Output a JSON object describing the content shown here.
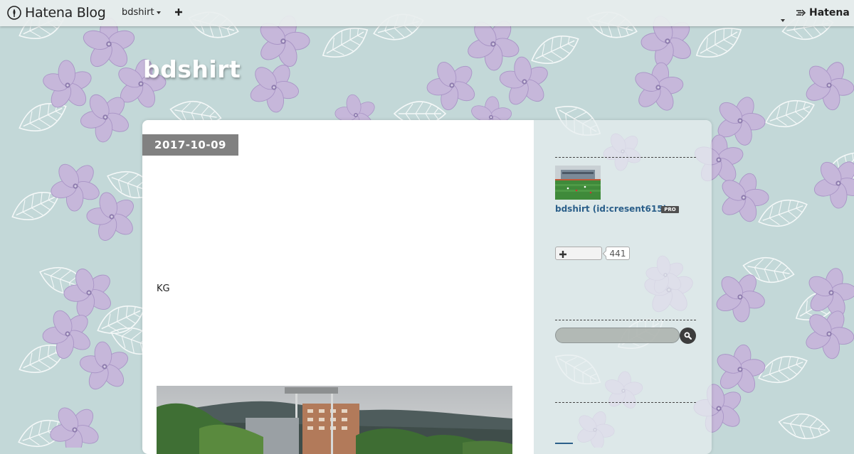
{
  "colors": {
    "background": "#c3d8d8",
    "flower": "#c6b7da",
    "leaf_stroke": "#f4f8f8",
    "date_badge": "#818181",
    "link": "#2b5f8a"
  },
  "navbar": {
    "logo_text": "Hatena Blog",
    "logo_icon": "hatena-blog-logo-icon",
    "blog_menu_label": "bdshirt",
    "add_icon": "plus-icon",
    "user_menu_icon": "caret-down-icon",
    "hatena_label": "Hatena",
    "hatena_icon": "hatena-logo-icon"
  },
  "blog": {
    "title": "bdshirt"
  },
  "entry": {
    "date": "2017-10-09",
    "text": "KG",
    "photo": "stadium-with-mountains-photo"
  },
  "sidebar": {
    "profile": {
      "thumbnail": "soccer-field-photo",
      "name": "bdshirt (id:cresent615)",
      "badge": "PRO"
    },
    "follow": {
      "icon": "plus-icon",
      "count": "441"
    },
    "search": {
      "placeholder": "",
      "icon": "search-icon"
    }
  }
}
